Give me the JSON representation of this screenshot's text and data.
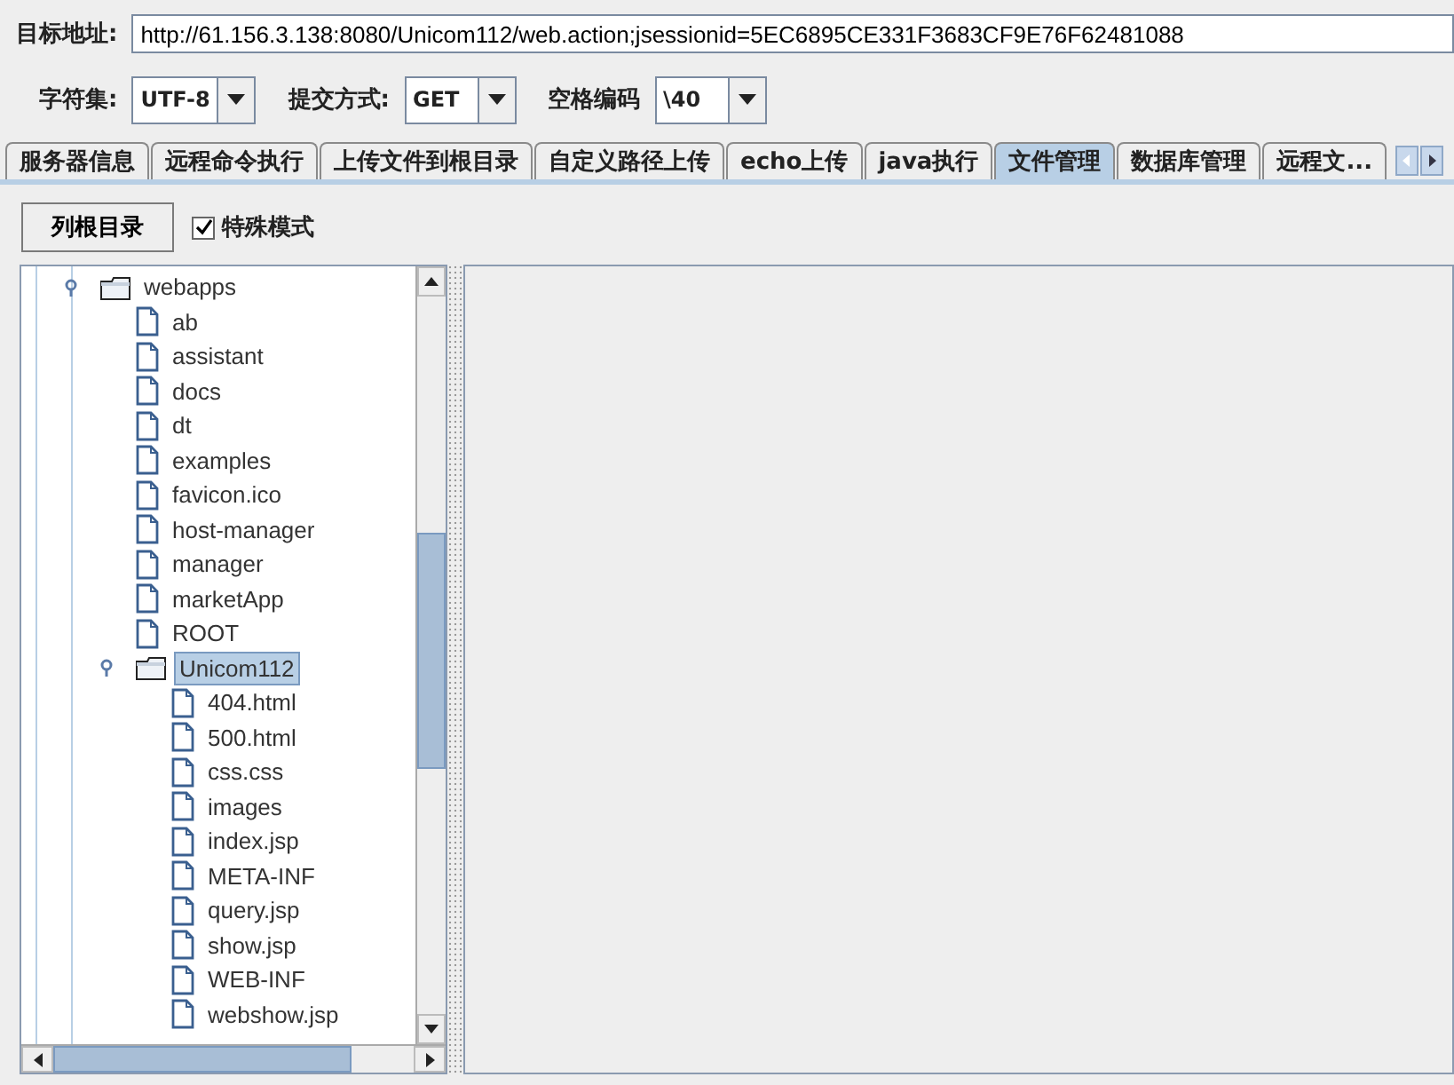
{
  "target": {
    "label": "目标地址:",
    "value": "http://61.156.3.138:8080/Unicom112/web.action;jsessionid=5EC6895CE331F3683CF9E76F62481088"
  },
  "options": [
    {
      "label": "字符集:",
      "value": "UTF-8"
    },
    {
      "label": "提交方式:",
      "value": "GET"
    },
    {
      "label": "空格编码",
      "value": "\\40"
    }
  ],
  "tabs": [
    {
      "label": "服务器信息",
      "selected": false
    },
    {
      "label": "远程命令执行",
      "selected": false
    },
    {
      "label": "上传文件到根目录",
      "selected": false
    },
    {
      "label": "自定义路径上传",
      "selected": false
    },
    {
      "label": "echo上传",
      "selected": false
    },
    {
      "label": "java执行",
      "selected": false
    },
    {
      "label": "文件管理",
      "selected": true
    },
    {
      "label": "数据库管理",
      "selected": false
    },
    {
      "label": "远程文...",
      "selected": false
    }
  ],
  "list_root_button": "列根目录",
  "special_mode": {
    "label": "特殊模式",
    "checked": true
  },
  "tree": [
    {
      "name": "webapps",
      "kind": "folder",
      "expanded": true,
      "selected": false,
      "children": [
        {
          "name": "ab",
          "kind": "file",
          "selected": false
        },
        {
          "name": "assistant",
          "kind": "file",
          "selected": false
        },
        {
          "name": "docs",
          "kind": "file",
          "selected": false
        },
        {
          "name": "dt",
          "kind": "file",
          "selected": false
        },
        {
          "name": "examples",
          "kind": "file",
          "selected": false
        },
        {
          "name": "favicon.ico",
          "kind": "file",
          "selected": false
        },
        {
          "name": "host-manager",
          "kind": "file",
          "selected": false
        },
        {
          "name": "manager",
          "kind": "file",
          "selected": false
        },
        {
          "name": "marketApp",
          "kind": "file",
          "selected": false
        },
        {
          "name": "ROOT",
          "kind": "file",
          "selected": false
        },
        {
          "name": "Unicom112",
          "kind": "folder",
          "expanded": true,
          "selected": true,
          "children": [
            {
              "name": "404.html",
              "kind": "file",
              "selected": false
            },
            {
              "name": "500.html",
              "kind": "file",
              "selected": false
            },
            {
              "name": "css.css",
              "kind": "file",
              "selected": false
            },
            {
              "name": "images",
              "kind": "file",
              "selected": false
            },
            {
              "name": "index.jsp",
              "kind": "file",
              "selected": false
            },
            {
              "name": "META-INF",
              "kind": "file",
              "selected": false
            },
            {
              "name": "query.jsp",
              "kind": "file",
              "selected": false
            },
            {
              "name": "show.jsp",
              "kind": "file",
              "selected": false
            },
            {
              "name": "WEB-INF",
              "kind": "file",
              "selected": false
            },
            {
              "name": "webshow.jsp",
              "kind": "file",
              "selected": false
            }
          ]
        }
      ]
    }
  ]
}
